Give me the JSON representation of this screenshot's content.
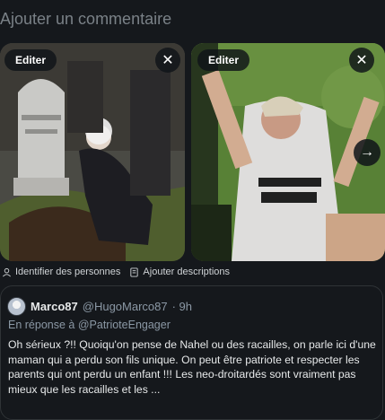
{
  "composer": {
    "placeholder": "Ajouter un commentaire"
  },
  "media": [
    {
      "edit_label": "Editer",
      "close_icon": "close-icon",
      "description": "Grandma Finds the Internet meme: old woman crouching by a gravestone"
    },
    {
      "edit_label": "Editer",
      "close_icon": "close-icon",
      "description": "Woman shouting in a white t-shirt at a protest"
    }
  ],
  "carousel": {
    "next_icon": "arrow-right-icon"
  },
  "tools": {
    "tag_people": "Identifier des personnes",
    "add_descriptions": "Ajouter descriptions"
  },
  "quoted_post": {
    "author": "Marco87",
    "handle": "@HugoMarco87",
    "time": "· 9h",
    "reply_prefix": "En réponse à",
    "reply_to": "@PatrioteEngager",
    "text": "Oh sérieux ?!! Quoiqu'on pense de Nahel ou des racailles, on parle ici d'une maman qui a perdu son fils unique. On peut être patriote et respecter les parents qui ont perdu un enfant !!! Les neo-droitardés sont vraiment pas mieux que les racailles et les ..."
  },
  "colors": {
    "background": "#15181c",
    "text": "#e7e9ea",
    "muted": "#8b98a5",
    "border": "#2f3336"
  }
}
